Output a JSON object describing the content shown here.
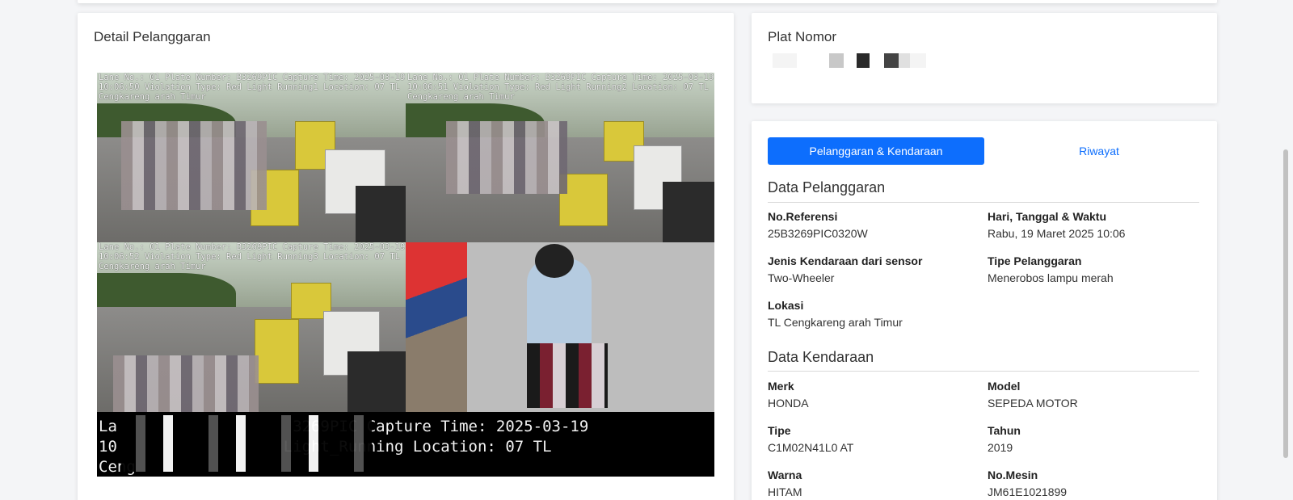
{
  "left_panel": {
    "title": "Detail Pelanggaran",
    "camera_overlays": [
      "Lane No.: 01 Plate Number: B3269PIC Capture Time: 2025-03-19\n10:06:50 Violation Type: Red Light Running1 Location: 07 TL\nCengkareng arah Timur",
      "Lane No.: 01 Plate Number: B3269PIC Capture Time: 2025-03-19\n10:06:51 Violation Type: Red Light Running2 Location: 07 TL\nCengkareng arah Timur",
      "Lane No.: 01 Plate Number: B3269PIC Capture Time: 2025-03-19\n10:06:52 Violation Type: Red Light Running3 Location: 07 TL\nCengkareng arah Timur"
    ],
    "bottom_strip": "La                   3269PIC Capture Time: 2025-03-19\n10                  Light_Running Location: 07 TL\nCeng"
  },
  "plate_card": {
    "label": "Plat Nomor"
  },
  "tabs": {
    "active": "Pelanggaran & Kendaraan",
    "inactive": "Riwayat"
  },
  "violation": {
    "section_title": "Data Pelanggaran",
    "ref_label": "No.Referensi",
    "ref_value": "25B3269PIC0320W",
    "datetime_label": "Hari, Tanggal & Waktu",
    "datetime_value": "Rabu, 19 Maret 2025 10:06",
    "vehicle_type_label": "Jenis Kendaraan dari sensor",
    "vehicle_type_value": "Two-Wheeler",
    "violation_type_label": "Tipe Pelanggaran",
    "violation_type_value": "Menerobos lampu merah",
    "location_label": "Lokasi",
    "location_value": "TL Cengkareng arah Timur"
  },
  "vehicle": {
    "section_title": "Data Kendaraan",
    "brand_label": "Merk",
    "brand_value": "HONDA",
    "model_label": "Model",
    "model_value": "SEPEDA MOTOR",
    "type_label": "Tipe",
    "type_value": "C1M02N41L0 AT",
    "year_label": "Tahun",
    "year_value": "2019",
    "color_label": "Warna",
    "color_value": "HITAM",
    "engine_label": "No.Mesin",
    "engine_value": "JM61E1021899"
  }
}
